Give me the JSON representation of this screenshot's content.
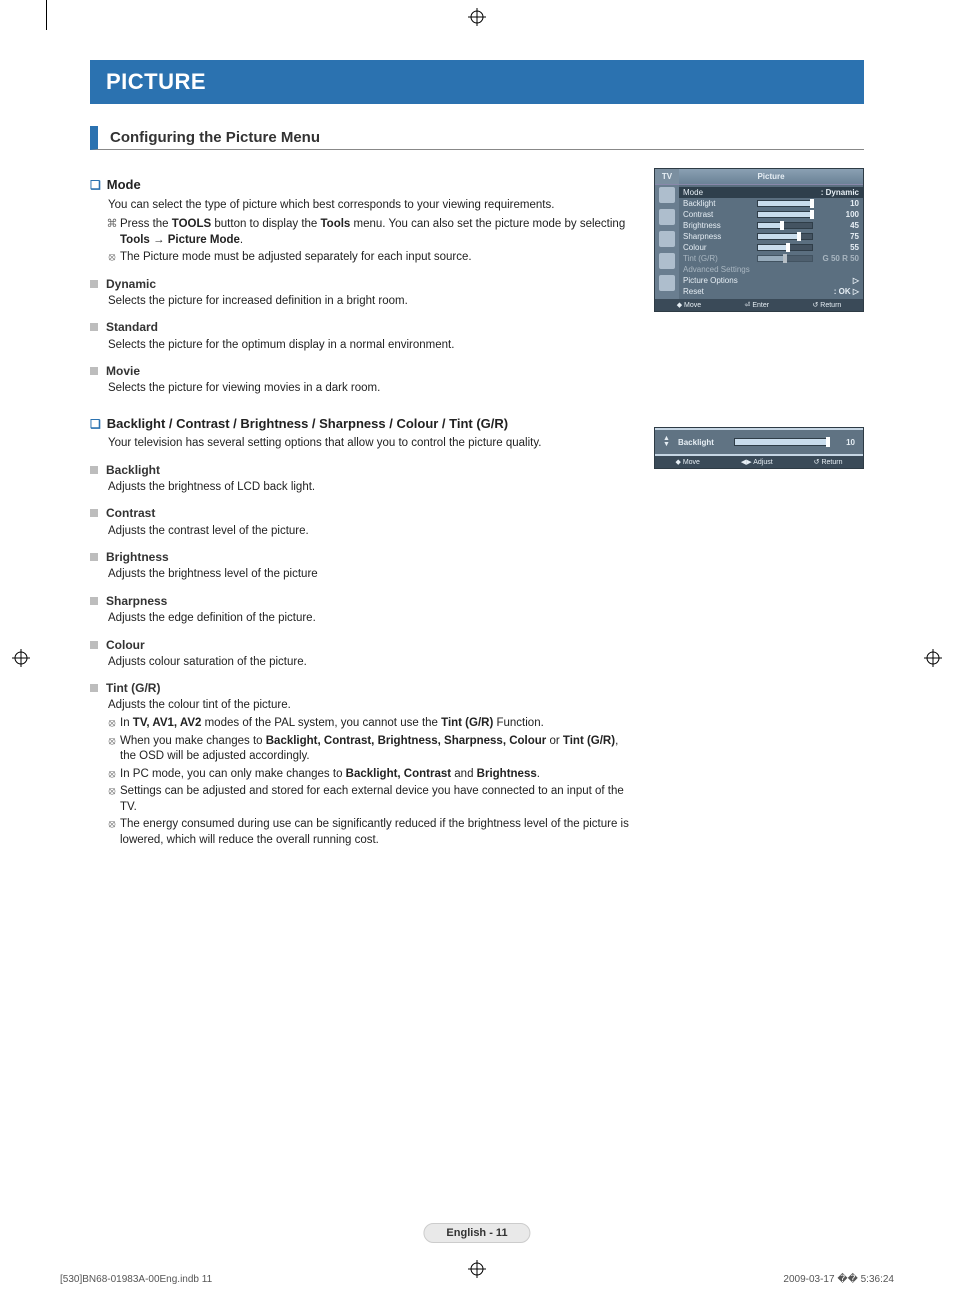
{
  "chapter": "PICTURE",
  "section_title": "Configuring the Picture Menu",
  "mode": {
    "heading": "Mode",
    "intro": "You can select the type of picture which best corresponds to your viewing requirements.",
    "tool_note_a": "Press the ",
    "tool_note_b": " button to display the ",
    "tool_note_c": " menu. You can also set the picture mode by selecting ",
    "tool_note_d": ".",
    "tools_word": "TOOLS",
    "tools_word2": "Tools",
    "tools_path": "Tools → Picture Mode",
    "note2": "The Picture mode must be adjusted separately for each input source.",
    "dynamic_h": "Dynamic",
    "dynamic_d": "Selects the picture for increased definition in a bright room.",
    "standard_h": "Standard",
    "standard_d": "Selects the picture for the optimum display in a normal environment.",
    "movie_h": "Movie",
    "movie_d": "Selects the picture for viewing movies in a dark room."
  },
  "sliders": {
    "heading": "Backlight / Contrast / Brightness / Sharpness / Colour / Tint (G/R)",
    "intro": "Your television has several setting options that allow you to control the picture quality.",
    "backlight_h": "Backlight",
    "backlight_d": "Adjusts the brightness of LCD back light.",
    "contrast_h": "Contrast",
    "contrast_d": "Adjusts the contrast level of the picture.",
    "brightness_h": "Brightness",
    "brightness_d": "Adjusts the brightness level of the picture",
    "sharpness_h": "Sharpness",
    "sharpness_d": "Adjusts the edge definition of the picture.",
    "colour_h": "Colour",
    "colour_d": "Adjusts colour saturation of the picture.",
    "tint_h": "Tint (G/R)",
    "tint_d": "Adjusts the colour tint of the picture.",
    "n1a": "In ",
    "n1b": " modes of the PAL system, you cannot use the ",
    "n1c": " Function.",
    "n1_modes": "TV, AV1, AV2",
    "n1_tint": "Tint (G/R)",
    "n2a": "When you make changes to ",
    "n2b": ", the OSD will be adjusted accordingly.",
    "n2_list": "Backlight, Contrast, Brightness, Sharpness, Colour",
    "n2_or": " or ",
    "n2_tint": "Tint (G/R)",
    "n3a": "In PC mode, you can only make changes to ",
    "n3b": " and ",
    "n3c": ".",
    "n3_list": "Backlight, Contrast",
    "n3_last": "Brightness",
    "n4": "Settings can be adjusted and stored for each external device you have connected to an input of the TV.",
    "n5": "The energy consumed during use can be significantly reduced if the brightness level of the picture is lowered, which will reduce the overall running cost."
  },
  "osd1": {
    "tv": "TV",
    "title": "Picture",
    "rows": [
      {
        "label": "Mode",
        "value": ": Dynamic",
        "fill": 0
      },
      {
        "label": "Backlight",
        "value": "10",
        "fill": 100
      },
      {
        "label": "Contrast",
        "value": "100",
        "fill": 100
      },
      {
        "label": "Brightness",
        "value": "45",
        "fill": 45
      },
      {
        "label": "Sharpness",
        "value": "75",
        "fill": 75
      },
      {
        "label": "Colour",
        "value": "55",
        "fill": 55
      },
      {
        "label": "Tint (G/R)",
        "value": "G 50      R 50",
        "fill": 50,
        "dim": true
      },
      {
        "label": "Advanced Settings",
        "value": "",
        "fill": 0,
        "dim": true
      },
      {
        "label": "Picture Options",
        "value": "▷",
        "fill": 0
      },
      {
        "label": "Reset",
        "value": ": OK               ▷",
        "fill": 0
      }
    ],
    "foot": [
      "◆ Move",
      "⏎ Enter",
      "↺ Return"
    ]
  },
  "osd2": {
    "label": "Backlight",
    "value": "10",
    "fill": 100,
    "foot": [
      "◆ Move",
      "◀▶ Adjust",
      "↺ Return"
    ]
  },
  "footer_lang": "English - ",
  "footer_page": "11",
  "print_left": "[530]BN68-01983A-00Eng.indb   11",
  "print_right": "2009-03-17   �� 5:36:24"
}
